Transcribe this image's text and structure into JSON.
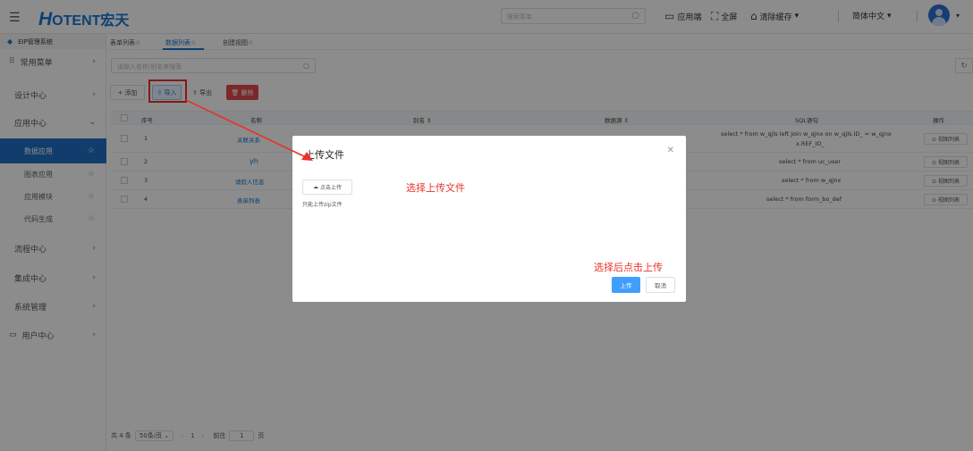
{
  "header": {
    "logo_prefix": "H",
    "logo_text": "OTENT",
    "logo_cn": "宏天",
    "search_placeholder": "搜索菜单",
    "app_label": "应用端",
    "fullscreen_label": "全屏",
    "clear_cache_label": "清除缓存",
    "language_label": "简体中文"
  },
  "sidebar": {
    "system_name": "EIP管理系统",
    "items": [
      {
        "label": "常用菜单"
      },
      {
        "label": "设计中心"
      },
      {
        "label": "应用中心"
      },
      {
        "label": "数据应用"
      },
      {
        "label": "图表应用"
      },
      {
        "label": "应用模块"
      },
      {
        "label": "代码生成"
      },
      {
        "label": "流程中心"
      },
      {
        "label": "集成中心"
      },
      {
        "label": "系统管理"
      },
      {
        "label": "用户中心"
      }
    ]
  },
  "tabs": [
    {
      "label": "表单列表☆"
    },
    {
      "label": "数据列表☆"
    },
    {
      "label": "创建视图☆"
    }
  ],
  "toolbar": {
    "search_placeholder": "请输入名称/别名来搜索",
    "add_label": "+ 添加",
    "import_label": "⇪ 导入",
    "export_label": "⇪ 导出",
    "delete_label": "🗑 删除"
  },
  "table": {
    "headers": {
      "index": "序号",
      "name": "名称",
      "alias": "别名 ⇕",
      "source": "数据源 ⇕",
      "sql": "SQL语句",
      "op": "操作"
    },
    "rows": [
      {
        "index": "1",
        "name": "关联关系",
        "sql_line1": "select * from w_qjls left join w_qjnx on w_qjls.ID_ = w_qjnx",
        "sql_line2": "x.REF_ID_",
        "op": "⊙ 视图列表"
      },
      {
        "index": "2",
        "name": "yh",
        "sql_line1": "select * from uc_user",
        "sql_line2": "",
        "op": "⊙ 视图列表"
      },
      {
        "index": "3",
        "name": "请假人信息",
        "sql_line1": "select * from w_qjnx",
        "sql_line2": "",
        "op": "⊙ 视图列表"
      },
      {
        "index": "4",
        "name": "表单列表",
        "sql_line1": "select * from form_bo_def",
        "sql_line2": "",
        "op": "⊙ 视图列表"
      }
    ]
  },
  "pager": {
    "total": "共 4 条",
    "page_size": "50条/页",
    "current_page": "1",
    "goto_label": "前往",
    "goto_value": "1",
    "page_unit": "页"
  },
  "modal": {
    "title": "上传文件",
    "upload_button": "点击上传",
    "tip": "只能上传zip文件",
    "annotation_select": "选择上传文件",
    "annotation_after": "选择后点击上传",
    "ok_label": "上传",
    "cancel_label": "取消"
  },
  "colors": {
    "primary": "#1677d2",
    "annotation_red": "#e8322b",
    "active_menu": "#1f6fc5",
    "danger": "#e24a4a"
  }
}
